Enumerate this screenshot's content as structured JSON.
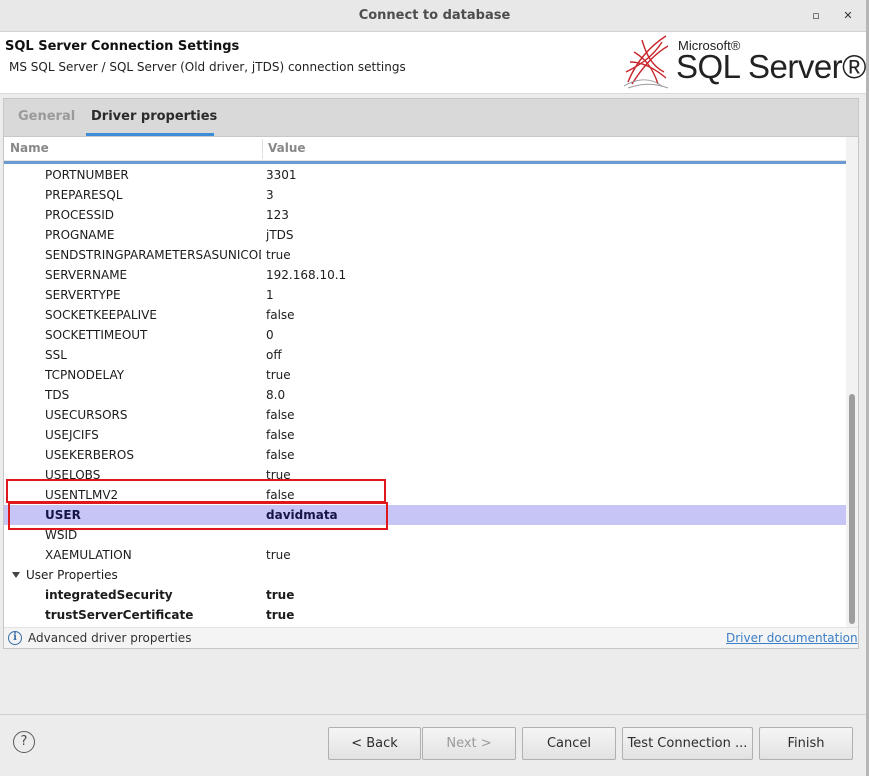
{
  "window": {
    "title": "Connect to database",
    "minimize_glyph": "▫",
    "close_glyph": "✕"
  },
  "header": {
    "title": "SQL Server Connection Settings",
    "subtitle": "MS SQL Server / SQL Server (Old driver, jTDS) connection settings",
    "logo": {
      "microsoft": "Microsoft®",
      "product": "SQL Server®"
    }
  },
  "tabs": [
    {
      "label": "General",
      "active": false
    },
    {
      "label": "Driver properties",
      "active": true
    }
  ],
  "table": {
    "columns": {
      "name": "Name",
      "value": "Value"
    },
    "rows": [
      {
        "name": "PORTNUMBER",
        "value": "3301"
      },
      {
        "name": "PREPARESQL",
        "value": "3"
      },
      {
        "name": "PROCESSID",
        "value": "123"
      },
      {
        "name": "PROGNAME",
        "value": "jTDS"
      },
      {
        "name": "SENDSTRINGPARAMETERSASUNICODE",
        "value": "true"
      },
      {
        "name": "SERVERNAME",
        "value": "192.168.10.1"
      },
      {
        "name": "SERVERTYPE",
        "value": "1"
      },
      {
        "name": "SOCKETKEEPALIVE",
        "value": "false"
      },
      {
        "name": "SOCKETTIMEOUT",
        "value": "0"
      },
      {
        "name": "SSL",
        "value": "off"
      },
      {
        "name": "TCPNODELAY",
        "value": "true"
      },
      {
        "name": "TDS",
        "value": "8.0"
      },
      {
        "name": "USECURSORS",
        "value": "false"
      },
      {
        "name": "USEJCIFS",
        "value": "false"
      },
      {
        "name": "USEKERBEROS",
        "value": "false"
      },
      {
        "name": "USELOBS",
        "value": "true"
      },
      {
        "name": "USENTLMV2",
        "value": "false"
      },
      {
        "name": "USER",
        "value": "davidmata",
        "selected": true
      },
      {
        "name": "WSID",
        "value": ""
      },
      {
        "name": "XAEMULATION",
        "value": "true"
      }
    ],
    "group": {
      "label": "User Properties",
      "expanded": true
    },
    "user_rows": [
      {
        "name": "integratedSecurity",
        "value": "true"
      },
      {
        "name": "trustServerCertificate",
        "value": "true"
      }
    ],
    "selection_color": "#c7c5f5",
    "highlight_color": "#e0181e"
  },
  "infobar": {
    "text": "Advanced driver properties",
    "link": "Driver documentation"
  },
  "buttons": {
    "back": "< Back",
    "next": "Next >",
    "cancel": "Cancel",
    "test": "Test Connection ...",
    "finish": "Finish",
    "help": "?"
  }
}
